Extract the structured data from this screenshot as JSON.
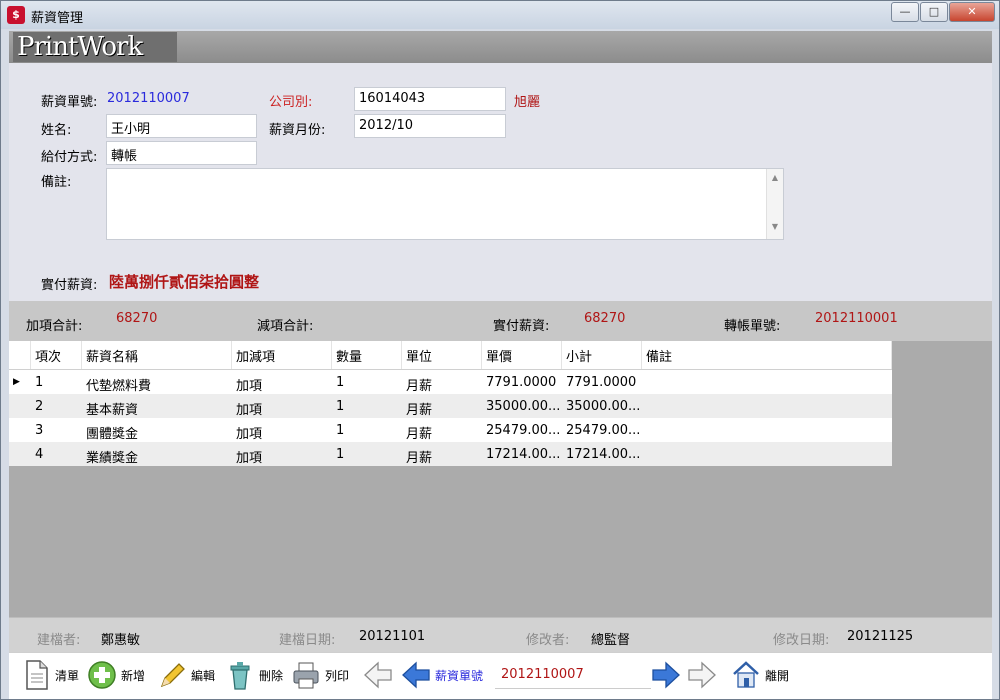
{
  "window": {
    "title": "薪資管理",
    "logo_text": "PrintWork",
    "controls": {
      "minimize": "—",
      "maximize": "□",
      "close": "✕"
    }
  },
  "form": {
    "slip_no_label": "薪資單號:",
    "slip_no": "2012110007",
    "company_label": "公司別:",
    "company_code": "16014043",
    "company_name": "旭麗",
    "name_label": "姓名:",
    "name": "王小明",
    "month_label": "薪資月份:",
    "month": "2012/10",
    "payment_label": "給付方式:",
    "payment": "轉帳",
    "memo_label": "備註:",
    "memo": "",
    "net_pay_label": "實付薪資:",
    "net_pay_words": "陸萬捌仟貳佰柒拾圓整"
  },
  "summary": {
    "add_total_label": "加項合計:",
    "add_total": "68270",
    "sub_total_label": "減項合計:",
    "sub_total": "",
    "net_label": "實付薪資:",
    "net": "68270",
    "transfer_no_label": "轉帳單號:",
    "transfer_no": "2012110001"
  },
  "grid": {
    "columns": [
      "項次",
      "薪資名稱",
      "加減項",
      "數量",
      "單位",
      "單價",
      "小計",
      "備註"
    ],
    "rows": [
      {
        "indicator": "▶",
        "no": "1",
        "name": "代墊燃料費",
        "type": "加項",
        "qty": "1",
        "unit": "月薪",
        "price": "7791.0000",
        "subtotal": "7791.0000",
        "note": ""
      },
      {
        "indicator": "",
        "no": "2",
        "name": "基本薪資",
        "type": "加項",
        "qty": "1",
        "unit": "月薪",
        "price": "35000.00...",
        "subtotal": "35000.00...",
        "note": ""
      },
      {
        "indicator": "",
        "no": "3",
        "name": "團體獎金",
        "type": "加項",
        "qty": "1",
        "unit": "月薪",
        "price": "25479.00...",
        "subtotal": "25479.00...",
        "note": ""
      },
      {
        "indicator": "",
        "no": "4",
        "name": "業績獎金",
        "type": "加項",
        "qty": "1",
        "unit": "月薪",
        "price": "17214.00...",
        "subtotal": "17214.00...",
        "note": ""
      }
    ]
  },
  "footer": {
    "creator_label": "建檔者:",
    "creator": "鄭惠敏",
    "created_label": "建檔日期:",
    "created": "20121101",
    "modifier_label": "修改者:",
    "modifier": "總監督",
    "modified_label": "修改日期:",
    "modified": "20121125"
  },
  "toolbar": {
    "list": "清單",
    "add": "新增",
    "edit": "編輯",
    "delete": "刪除",
    "print": "列印",
    "nav_label": "薪資單號",
    "nav_value": "2012110007",
    "exit": "離開"
  },
  "colors": {
    "accent_blue": "#2a2adc",
    "accent_red": "#cc2222",
    "value_red": "#b01515"
  }
}
